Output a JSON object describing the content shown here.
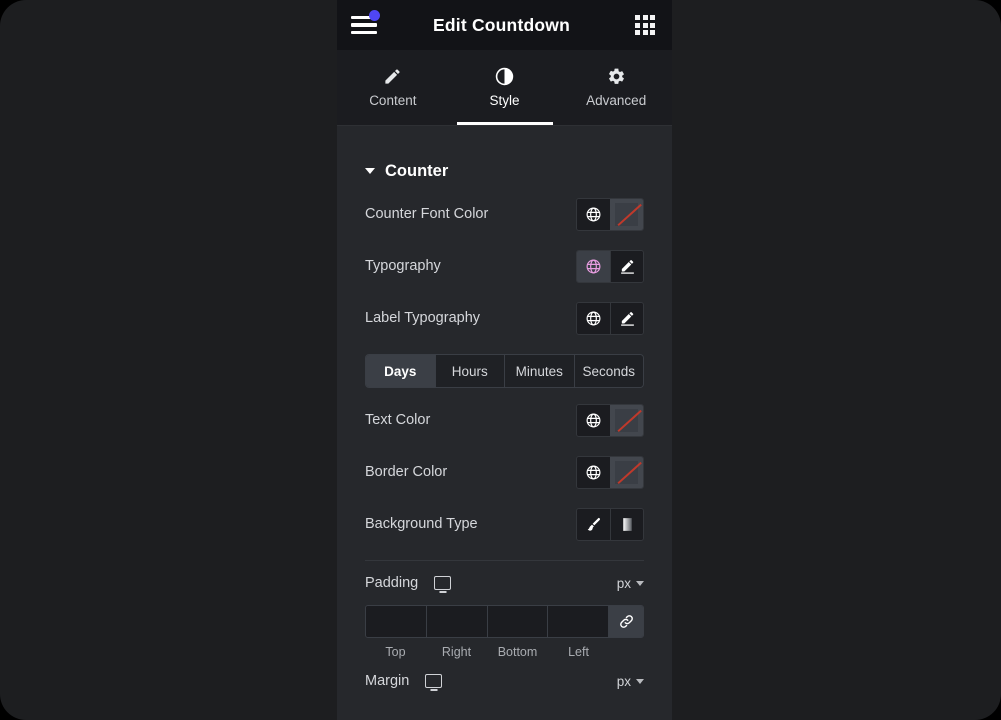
{
  "window": {
    "background_color": "#1d1e20",
    "panel_color": "#26282c"
  },
  "topbar": {
    "title": "Edit Countdown",
    "menu_icon": "hamburger-icon",
    "notification_dot_color": "#4f46f5",
    "apps_icon": "grid-apps-icon"
  },
  "tabs": [
    {
      "label": "Content",
      "icon": "pencil-icon",
      "active": false
    },
    {
      "label": "Style",
      "icon": "contrast-icon",
      "active": true
    },
    {
      "label": "Advanced",
      "icon": "gear-icon",
      "active": false
    }
  ],
  "section": {
    "title": "Counter",
    "expanded": true,
    "caret_icon": "caret-down-icon"
  },
  "controls": [
    {
      "label": "Counter Font Color",
      "left_icon": "globe-icon",
      "left_icon_color": "#ffffff",
      "left_highlighted": false,
      "right_type": "color-swatch",
      "right_icon": "no-color-swatch",
      "swatch_slash_color": "#c0392b"
    },
    {
      "label": "Typography",
      "left_icon": "globe-icon",
      "left_icon_color": "#e79de0",
      "left_highlighted": true,
      "right_type": "edit",
      "right_icon": "pencil-edit-icon"
    },
    {
      "label": "Label Typography",
      "left_icon": "globe-icon",
      "left_icon_color": "#ffffff",
      "left_highlighted": false,
      "right_type": "edit",
      "right_icon": "pencil-edit-icon"
    }
  ],
  "time_unit_tabs": {
    "items": [
      "Days",
      "Hours",
      "Minutes",
      "Seconds"
    ],
    "selected": "Days"
  },
  "controls2": [
    {
      "label": "Text Color",
      "left_icon": "globe-icon",
      "right_type": "color-swatch",
      "right_icon": "no-color-swatch"
    },
    {
      "label": "Border Color",
      "left_icon": "globe-icon",
      "right_type": "color-swatch",
      "right_icon": "no-color-swatch"
    },
    {
      "label": "Background Type",
      "left_icon": "brush-icon",
      "right_type": "gradient",
      "right_icon": "gradient-icon"
    }
  ],
  "padding": {
    "label": "Padding",
    "device_icon": "desktop-monitor-icon",
    "unit": "px",
    "unit_caret_icon": "chevron-down-icon",
    "link_icon": "link-chain-icon",
    "linked": true,
    "fields": [
      {
        "side": "Top",
        "value": ""
      },
      {
        "side": "Right",
        "value": ""
      },
      {
        "side": "Bottom",
        "value": ""
      },
      {
        "side": "Left",
        "value": ""
      }
    ]
  },
  "margin": {
    "label": "Margin",
    "device_icon": "desktop-monitor-icon",
    "unit": "px",
    "unit_caret_icon": "chevron-down-icon"
  }
}
